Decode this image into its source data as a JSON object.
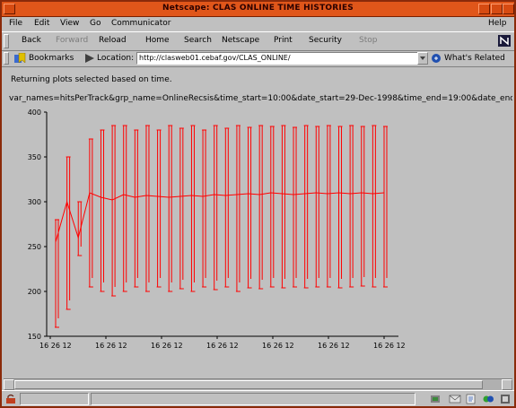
{
  "window": {
    "title": "Netscape: CLAS ONLINE TIME HISTORIES"
  },
  "menu": {
    "items": [
      "File",
      "Edit",
      "View",
      "Go",
      "Communicator"
    ],
    "help": "Help"
  },
  "toolbar": {
    "items": [
      "Back",
      "Forward",
      "Reload",
      "Home",
      "Search",
      "Netscape",
      "Print",
      "Security",
      "Stop"
    ],
    "disabled": [
      "Forward",
      "Stop"
    ]
  },
  "location": {
    "bookmarks_label": "Bookmarks",
    "location_label": "Location:",
    "url": "http://clasweb01.cebaf.gov/CLAS_ONLINE/",
    "related_label": "What's Related"
  },
  "page": {
    "message": "Returning plots selected based on time.",
    "query": "var_names=hitsPerTrack&grp_name=OnlineRecsis&time_start=10:00&date_start=29-Dec-1998&time_end=19:00&date_end"
  },
  "chart_data": {
    "type": "line",
    "color": "#ff0000",
    "ylim": [
      150,
      400
    ],
    "y_ticks": [
      "400",
      "350",
      "300",
      "250",
      "200",
      "150"
    ],
    "x_ticks": [
      "16 26 12",
      "16 26 12",
      "16 26 12",
      "16 26 12",
      "16 26 12",
      "16 26 12",
      "16 26 12"
    ],
    "series": [
      {
        "points": [
          [
            0,
            280,
            160,
            255
          ],
          [
            1,
            350,
            180,
            300
          ],
          [
            2,
            300,
            240,
            260
          ],
          [
            3,
            370,
            205,
            310
          ],
          [
            4,
            380,
            200,
            305
          ],
          [
            5,
            385,
            195,
            302
          ],
          [
            6,
            385,
            200,
            308
          ],
          [
            7,
            380,
            205,
            305
          ],
          [
            8,
            385,
            200,
            307
          ],
          [
            9,
            380,
            205,
            306
          ],
          [
            10,
            385,
            200,
            305
          ],
          [
            11,
            382,
            203,
            306
          ],
          [
            12,
            385,
            200,
            307
          ],
          [
            13,
            380,
            205,
            306
          ],
          [
            14,
            385,
            202,
            308
          ],
          [
            15,
            382,
            205,
            307
          ],
          [
            16,
            385,
            200,
            308
          ],
          [
            17,
            383,
            204,
            309
          ],
          [
            18,
            385,
            203,
            308
          ],
          [
            19,
            384,
            205,
            310
          ],
          [
            20,
            385,
            204,
            309
          ],
          [
            21,
            383,
            205,
            308
          ],
          [
            22,
            385,
            204,
            309
          ],
          [
            23,
            384,
            205,
            310
          ],
          [
            24,
            385,
            205,
            309
          ],
          [
            25,
            384,
            204,
            310
          ],
          [
            26,
            385,
            205,
            309
          ],
          [
            27,
            384,
            206,
            310
          ],
          [
            28,
            385,
            205,
            309
          ],
          [
            29,
            384,
            205,
            310
          ]
        ]
      }
    ]
  }
}
